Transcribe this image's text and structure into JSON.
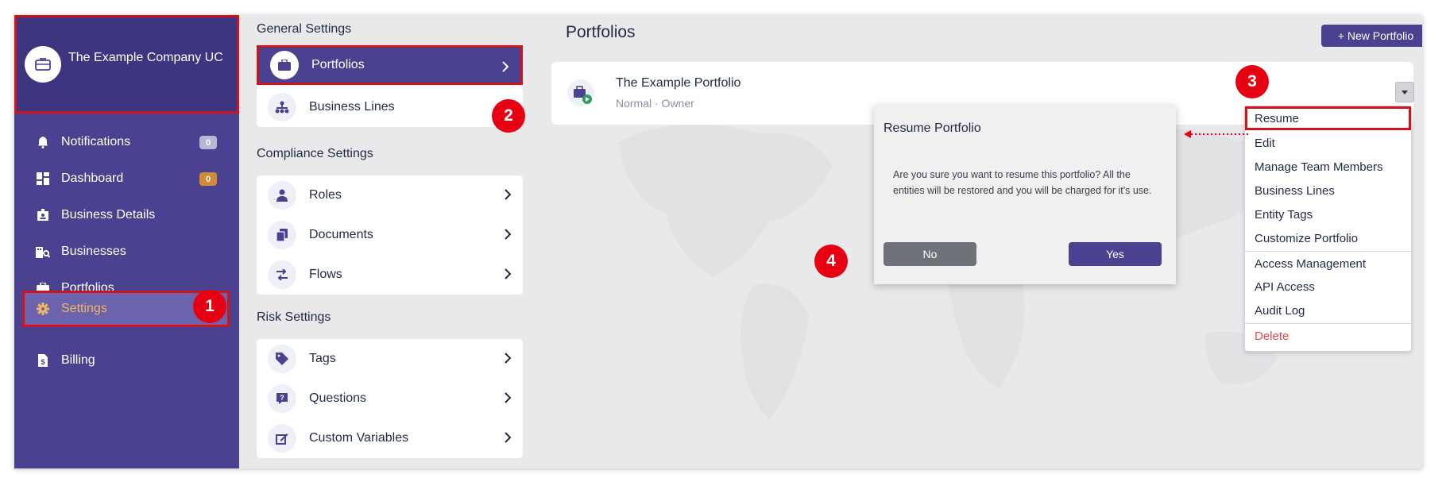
{
  "sidebar": {
    "company_name": "The Example Company UC",
    "items": [
      {
        "label": "Notifications",
        "badge": "0",
        "badge_color": "#b9b7d6"
      },
      {
        "label": "Dashboard",
        "badge": "0",
        "badge_color": "#d28b35"
      },
      {
        "label": "Business Details"
      },
      {
        "label": "Businesses"
      },
      {
        "label": "Portfolios"
      },
      {
        "label": "Settings"
      },
      {
        "label": "Billing"
      }
    ]
  },
  "settings": {
    "general_title": "General Settings",
    "general_items": [
      "Portfolios",
      "Business Lines"
    ],
    "compliance_title": "Compliance Settings",
    "compliance_items": [
      "Roles",
      "Documents",
      "Flows"
    ],
    "risk_title": "Risk Settings",
    "risk_items": [
      "Tags",
      "Questions",
      "Custom Variables"
    ]
  },
  "main": {
    "title": "Portfolios",
    "new_button": "+ New Portfolio",
    "portfolio": {
      "name": "The Example Portfolio",
      "meta": "Normal · Owner"
    }
  },
  "menu": {
    "items": [
      "Resume",
      "Edit",
      "Manage Team Members",
      "Business Lines",
      "Entity Tags",
      "Customize Portfolio",
      "Access Management",
      "API Access",
      "Audit Log",
      "Delete"
    ]
  },
  "modal": {
    "title": "Resume Portfolio",
    "body": "Are you sure you want to resume this portfolio? All the entities will be restored and you will be charged for it's use.",
    "no_label": "No",
    "yes_label": "Yes"
  },
  "markers": [
    "1",
    "2",
    "3",
    "4"
  ],
  "colors": {
    "brand": "#4a4291",
    "accent": "#f2b662",
    "highlight": "#d0121b",
    "danger": "#e44a4a"
  }
}
